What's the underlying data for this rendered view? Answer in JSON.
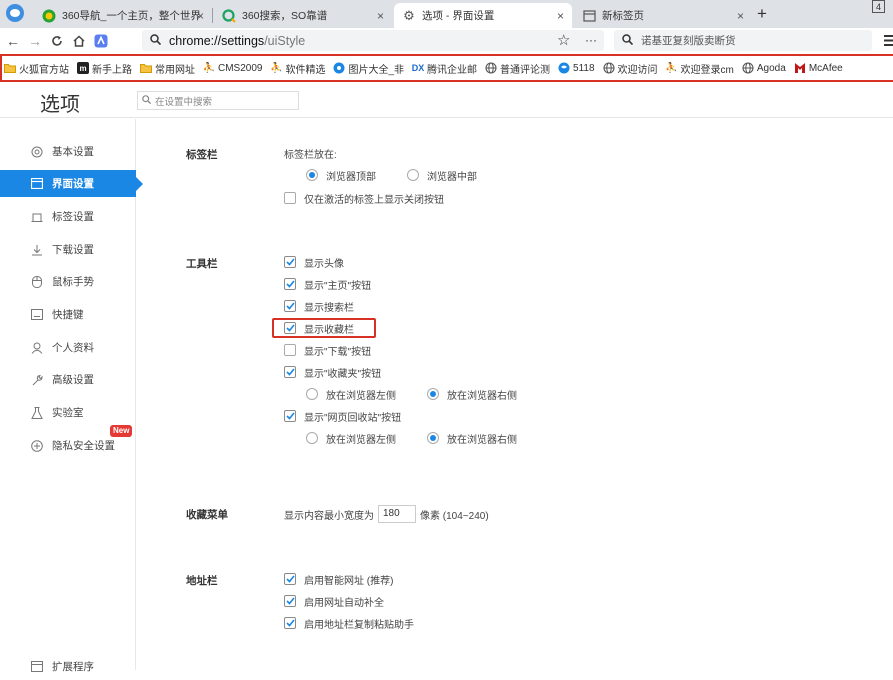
{
  "tabs": [
    {
      "label": "360导航_一个主页，整个世界",
      "icon": "360-nav-icon"
    },
    {
      "label": "360搜索，SO靠谱",
      "icon": "360-search-icon"
    },
    {
      "label": "选项 - 界面设置",
      "icon": "gear-icon",
      "active": true
    },
    {
      "label": "新标签页",
      "icon": "new-tab-icon"
    }
  ],
  "tab_close": "×",
  "new_tab": "+",
  "window_badge": "4",
  "address": {
    "host": "chrome://settings",
    "path": "/uiStyle"
  },
  "search_box": "诺基亚复刻版卖断货",
  "bookmarks": [
    {
      "label": "火狐官方站",
      "icon": "folder-icon",
      "color": "#f5b400"
    },
    {
      "label": "新手上路",
      "icon": "m-icon",
      "color": "#222222"
    },
    {
      "label": "常用网址",
      "icon": "folder-icon",
      "color": "#f5b400"
    },
    {
      "label": "CMS2009",
      "icon": "runner-icon",
      "color": "#1b87e5"
    },
    {
      "label": "软件精选",
      "icon": "runner-icon",
      "color": "#1b87e5"
    },
    {
      "label": "图片大全_非",
      "icon": "globe-blue-icon",
      "color": "#1b87e5"
    },
    {
      "label": "腾讯企业邮",
      "icon": "dx-icon",
      "color": "#1b6ac9"
    },
    {
      "label": "普通评论测",
      "icon": "globe-icon",
      "color": "#555555"
    },
    {
      "label": "5118",
      "icon": "5118-icon",
      "color": "#1b87e5"
    },
    {
      "label": "欢迎访问",
      "icon": "globe-icon",
      "color": "#555555"
    },
    {
      "label": "欢迎登录cm",
      "icon": "runner-icon",
      "color": "#1b87e5"
    },
    {
      "label": "Agoda",
      "icon": "globe-icon",
      "color": "#555555"
    },
    {
      "label": "McAfee",
      "icon": "mcafee-icon",
      "color": "#c01818"
    }
  ],
  "settings": {
    "title": "选项",
    "search_placeholder": "在设置中搜索"
  },
  "sidebar": [
    {
      "label": "基本设置",
      "icon": "target-icon"
    },
    {
      "label": "界面设置",
      "icon": "window-icon",
      "active": true
    },
    {
      "label": "标签设置",
      "icon": "tab-icon"
    },
    {
      "label": "下载设置",
      "icon": "download-icon"
    },
    {
      "label": "鼠标手势",
      "icon": "mouse-icon"
    },
    {
      "label": "快捷键",
      "icon": "keyboard-icon"
    },
    {
      "label": "个人资料",
      "icon": "person-icon"
    },
    {
      "label": "高级设置",
      "icon": "wrench-icon"
    },
    {
      "label": "实验室",
      "icon": "flask-icon"
    },
    {
      "label": "隐私安全设置",
      "icon": "shield-plus-icon",
      "badge": "New"
    },
    {
      "label": "扩展程序",
      "icon": "extension-icon"
    }
  ],
  "sections": {
    "tabbar": {
      "label": "标签栏",
      "position_label": "标签栏放在:",
      "options": [
        {
          "label": "浏览器顶部",
          "selected": true
        },
        {
          "label": "浏览器中部",
          "selected": false
        }
      ],
      "close_btn_label": "仅在激活的标签上显示关闭按钮",
      "close_btn_checked": false
    },
    "toolbar": {
      "label": "工具栏",
      "items": [
        {
          "label": "显示头像",
          "checked": true
        },
        {
          "label": "显示\"主页\"按钮",
          "checked": true
        },
        {
          "label": "显示搜索栏",
          "checked": true
        },
        {
          "label": "显示收藏栏",
          "checked": true
        },
        {
          "label": "显示\"下载\"按钮",
          "checked": false
        },
        {
          "label": "显示\"收藏夹\"按钮",
          "checked": true
        },
        {
          "label": "显示\"网页回收站\"按钮",
          "checked": true
        }
      ],
      "side_left": "放在浏览器左侧",
      "side_right": "放在浏览器右侧"
    },
    "favorites": {
      "label": "收藏菜单",
      "width_prefix": "显示内容最小宽度为",
      "width_value": "180",
      "width_suffix": "像素 (104~240)"
    },
    "addressbar": {
      "label": "地址栏",
      "items": [
        {
          "label": "启用智能网址 (推荐)",
          "checked": true
        },
        {
          "label": "启用网址自动补全",
          "checked": true
        },
        {
          "label": "启用地址栏复制粘贴助手",
          "checked": true
        }
      ]
    }
  },
  "colors": {
    "accent": "#1b87e5",
    "highlight": "#d93025"
  }
}
